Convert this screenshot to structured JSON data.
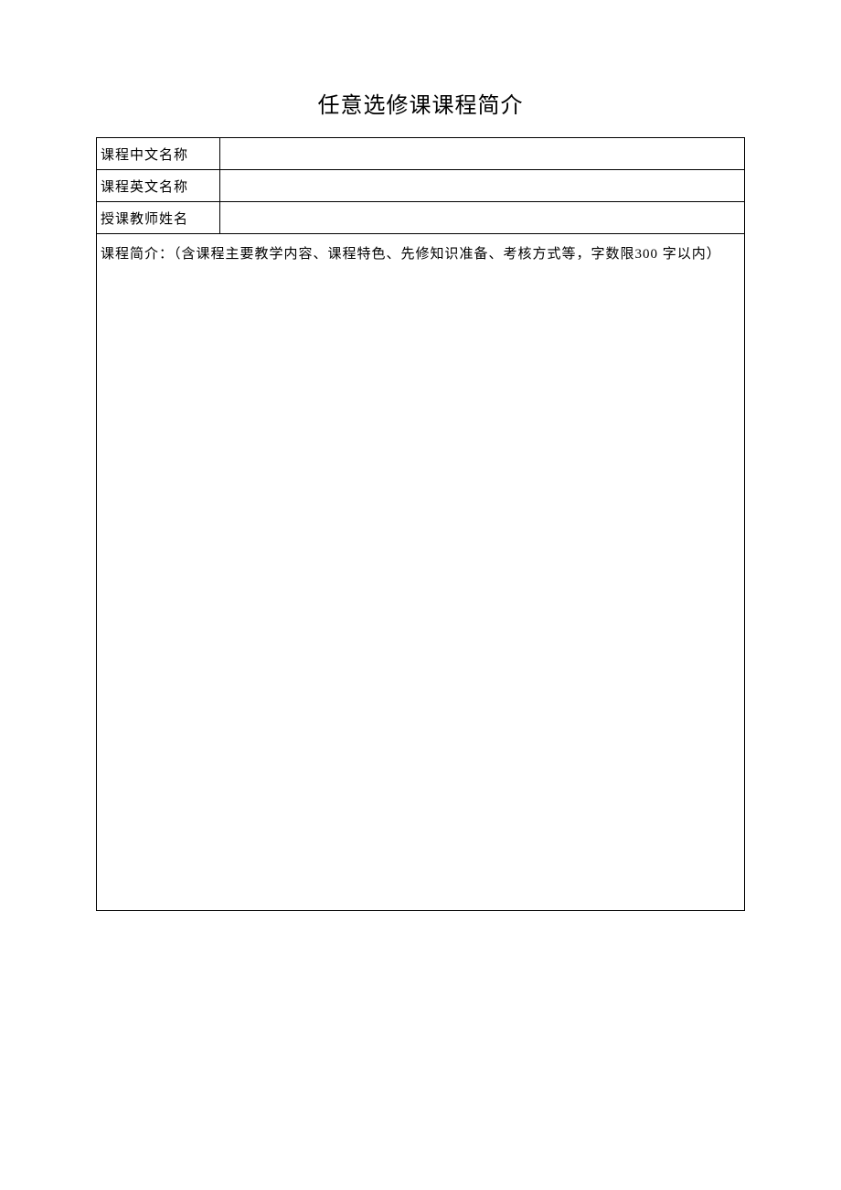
{
  "title": "任意选修课课程简介",
  "fields": {
    "row1": {
      "label": "课程中文名称",
      "value": ""
    },
    "row2": {
      "label": "课程英文名称",
      "value": ""
    },
    "row3": {
      "label": "授课教师姓名",
      "value": ""
    }
  },
  "description": {
    "label": "课程简介：（含课程主要教学内容、课程特色、先修知识准备、考核方式等，字数限300 字以内）",
    "value": ""
  }
}
